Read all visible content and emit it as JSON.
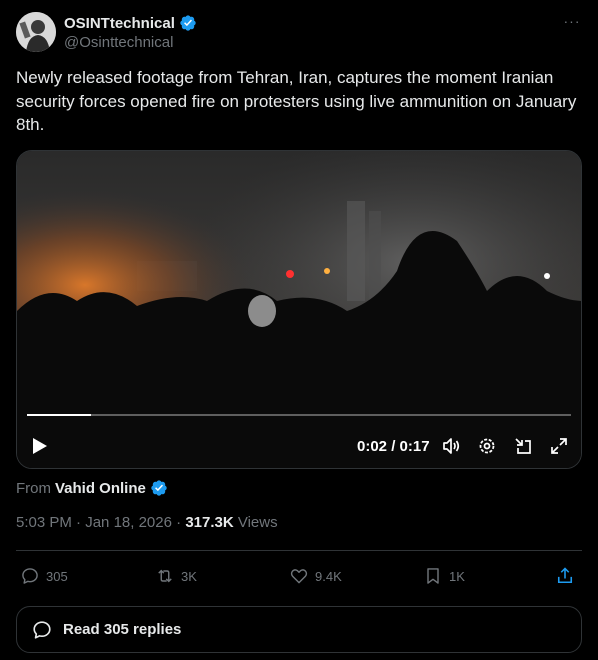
{
  "author": {
    "display_name": "OSINTtechnical",
    "handle": "@Osinttechnical",
    "verified": true,
    "avatar_icon": "avatar-image"
  },
  "more_icon": "more-icon",
  "more_glyph": "···",
  "tweet": {
    "text": "Newly released footage from Tehran, Iran, captures the moment Iranian security forces opened fire on protesters using live ammunition on January 8th."
  },
  "video": {
    "time": "0:02 / 0:17",
    "progress": 0.118,
    "controls": [
      "play-icon",
      "volume-icon",
      "settings-icon",
      "pip-icon",
      "fullscreen-icon"
    ]
  },
  "source": {
    "prefix": "From",
    "name": "Vahid Online",
    "verified": true
  },
  "meta": {
    "time": "5:03 PM",
    "sep1": " · ",
    "date": "Jan 18, 2026",
    "sep2": " · ",
    "views_count": "317.3K",
    "views_label": " Views"
  },
  "actions": {
    "replies": "305",
    "reposts": "3K",
    "likes": "9.4K",
    "bookmarks": "1K"
  },
  "read_replies_label": "Read 305 replies",
  "colors": {
    "background": "#000000",
    "text_primary": "#e7e9ea",
    "text_secondary": "#71767b",
    "verified_blue": "#1d9bf0",
    "share_blue": "#1d9bf0",
    "border": "#2f3336"
  }
}
